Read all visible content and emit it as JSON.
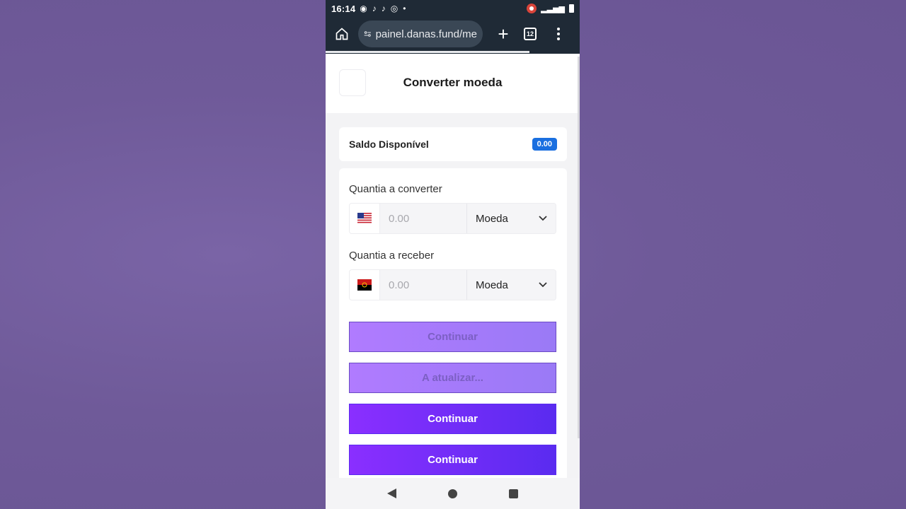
{
  "status_bar": {
    "time": "16:14",
    "icons_left": [
      "target-icon",
      "tiktok-icon",
      "tiktok-icon",
      "instagram-icon",
      "dot-icon"
    ],
    "icons_right": [
      "screen-record-icon",
      "signal-icon",
      "battery-icon"
    ]
  },
  "browser": {
    "url": "painel.danas.fund/me",
    "tabs_count": "12"
  },
  "page": {
    "title": "Converter moeda",
    "balance_label": "Saldo Disponível",
    "balance_value": "0.00",
    "convert_from": {
      "label": "Quantia a converter",
      "placeholder": "0.00",
      "currency": "Moeda",
      "flag": "us-flag-icon"
    },
    "convert_to": {
      "label": "Quantia a receber",
      "placeholder": "0.00",
      "currency": "Moeda",
      "flag": "angola-flag-icon"
    },
    "buttons": {
      "continue_disabled": "Continuar",
      "updating": "A atualizar...",
      "continue_1": "Continuar",
      "continue_2": "Continuar"
    }
  },
  "colors": {
    "accent": "#6a2cf6",
    "accent_disabled": "#a77bff",
    "badge": "#1a6fe0",
    "browser_bar": "#1f2a36",
    "backdrop": "#6f5a99"
  }
}
